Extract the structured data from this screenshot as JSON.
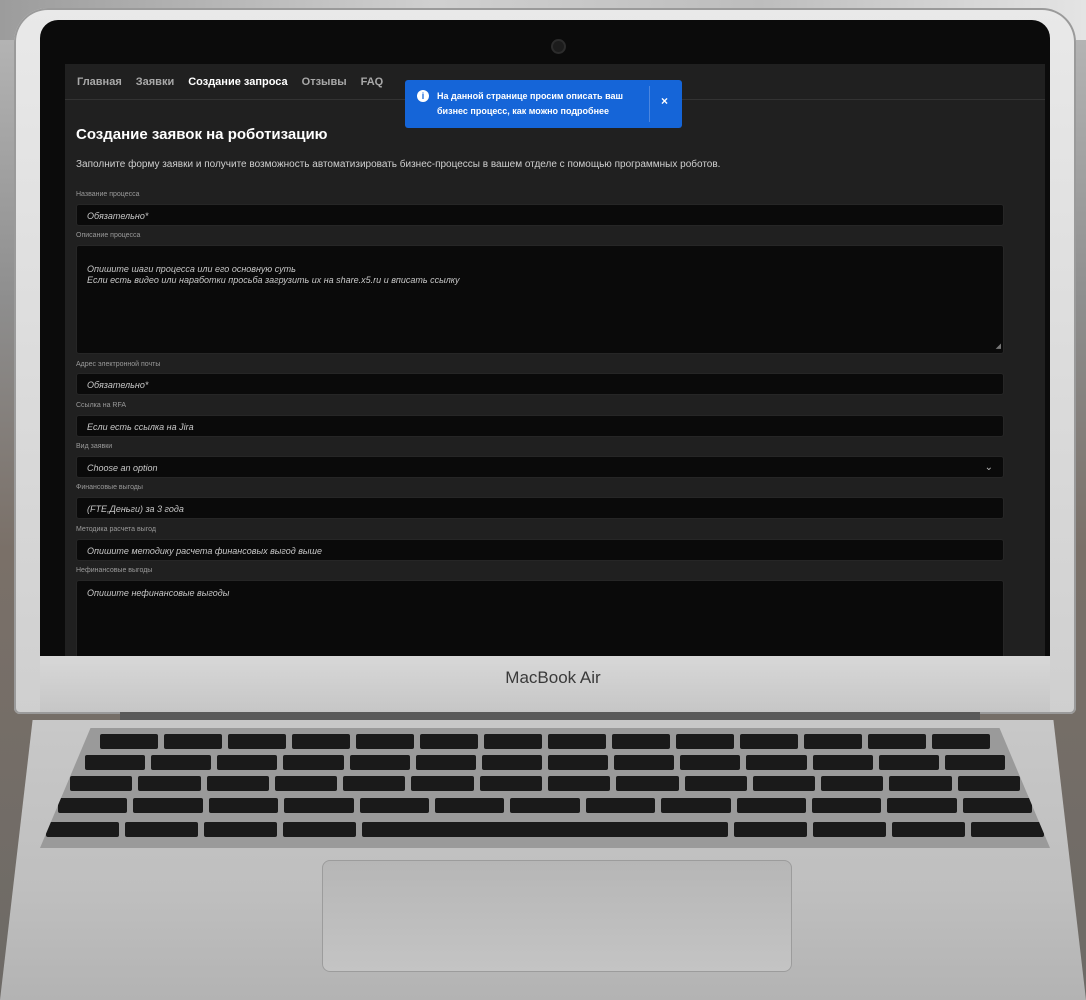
{
  "device": {
    "brand": "MacBook Air"
  },
  "nav": {
    "items": [
      {
        "label": "Главная",
        "active": false
      },
      {
        "label": "Заявки",
        "active": false
      },
      {
        "label": "Создание запроса",
        "active": true
      },
      {
        "label": "Отзывы",
        "active": false
      },
      {
        "label": "FAQ",
        "active": false
      }
    ]
  },
  "toast": {
    "icon": "info-icon",
    "line1": "На данной странице просим описать ваш",
    "line2": "бизнес процесс, как можно подробнее",
    "close": "×"
  },
  "page": {
    "title": "Создание заявок на роботизацию",
    "subtitle": "Заполните форму заявки и получите возможность автоматизировать бизнес-процессы в вашем отделе с помощью программных роботов."
  },
  "form": {
    "process_name": {
      "label": "Название процесса",
      "placeholder": "Обязательно*"
    },
    "process_description": {
      "label": "Описание процесса",
      "placeholder": "Опишите шаги процесса или его основную суть\nЕсли есть видео или наработки просьба загрузить их на share.x5.ru и вписать ссылку"
    },
    "email": {
      "label": "Адрес электронной почты",
      "placeholder": "Обязательно*"
    },
    "rfa_link": {
      "label": "Ссылка на RFA",
      "placeholder": "Если есть ссылка на Jira"
    },
    "request_type": {
      "label": "Вид заявки",
      "value": "Choose an option"
    },
    "financial_benefits": {
      "label": "Финансовые выгоды",
      "placeholder": "(FTE,Деньги) за 3 года"
    },
    "calc_method": {
      "label": "Методика расчета выгод",
      "placeholder": "Опишите методику расчета финансовых выгод выше"
    },
    "non_financial": {
      "label": "Нефинансовые выгоды",
      "placeholder": "Опишите нефинансовые выгоды"
    }
  }
}
